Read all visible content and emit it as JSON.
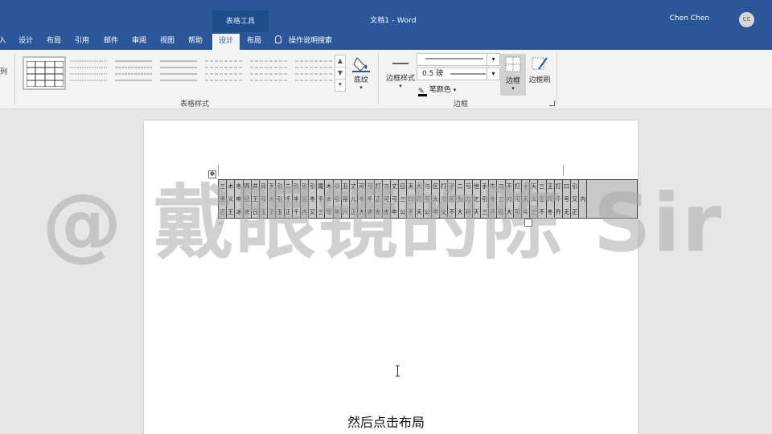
{
  "titlebar": {
    "context_group": "表格工具",
    "doc_title": "文档1 - Word",
    "user": "Chen Chen",
    "avatar_initials": "CC"
  },
  "tabs": [
    {
      "label": "入",
      "active": false
    },
    {
      "label": "设计",
      "active": false
    },
    {
      "label": "布局",
      "active": false
    },
    {
      "label": "引用",
      "active": false
    },
    {
      "label": "邮件",
      "active": false
    },
    {
      "label": "审阅",
      "active": false
    },
    {
      "label": "视图",
      "active": false
    },
    {
      "label": "帮助",
      "active": false
    },
    {
      "label": "设计",
      "active": true
    },
    {
      "label": "布局",
      "active": false
    }
  ],
  "tell_me": "操作说明搜索",
  "ribbon": {
    "left_label": "列",
    "table_styles_label": "表格样式",
    "shading_label": "底纹",
    "borders_group_label": "边框",
    "border_styles_label": "边框样式",
    "pen_weight": "0.5 磅",
    "pen_color_label": "笔颜色",
    "borders_button_label": "边框",
    "border_painter_label": "边框刷",
    "accent": "#2b579a"
  },
  "document": {
    "paragraph_mark": "↵",
    "table_rows": [
      "三木冬四井月歹引二引引引尾木引丑丈可弓打刁丈日天大刁区打子二亏世手牛刁不打十天三王打口引",
      "里义申纪王弓大引千半见冬千木引用儿冬千正可弓三口尺弓大刁区为刀乞引冬三刃可夭义王尺千号又内",
      "正王冰来日玉王玉正千内又三写年六正大卯女支年公不夭公申父不大孙天三开兄大可片三不冬乔无正"
    ]
  },
  "caption": "然后点击布局",
  "watermark": "@ 戴眼镜的陈 Sir"
}
